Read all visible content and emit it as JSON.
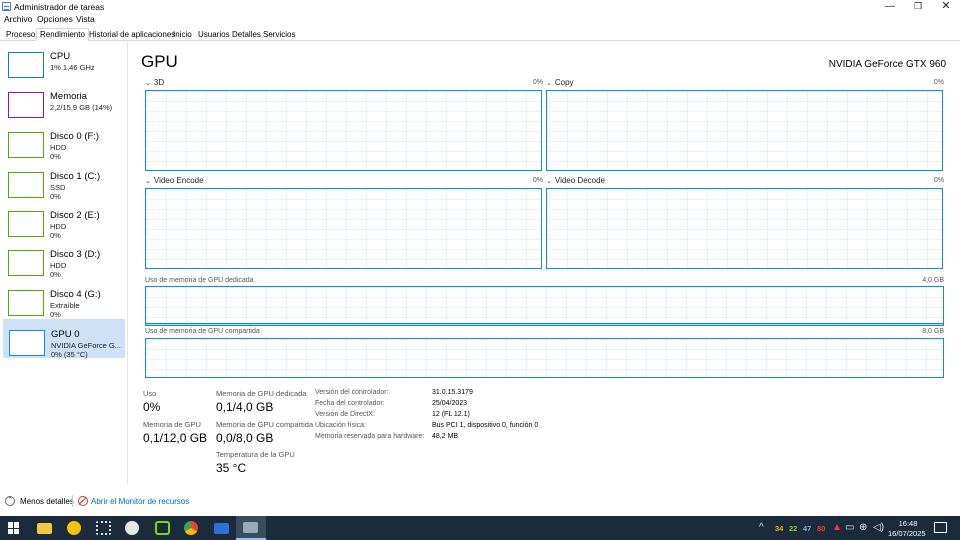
{
  "window": {
    "title": "Administrador de tareas",
    "minimize": "—",
    "maximize": "❐",
    "close": "✕"
  },
  "menu": [
    "Archivo",
    "Opciones",
    "Vista"
  ],
  "tabs": [
    "Procesos",
    "Rendimiento",
    "Historial de aplicaciones",
    "Inicio",
    "Usuarios",
    "Detalles",
    "Servicios"
  ],
  "active_tab": "Rendimiento",
  "sidebar": [
    {
      "name": "CPU",
      "line1": "1% 1,46 GHz",
      "line2": "",
      "color": "#117dbb"
    },
    {
      "name": "Memoria",
      "line1": "2,2/15,9 GB (14%)",
      "line2": "",
      "color": "#8b12ae"
    },
    {
      "name": "Disco 0 (F:)",
      "line1": "HDD",
      "line2": "0%",
      "color": "#4da60c"
    },
    {
      "name": "Disco 1 (C:)",
      "line1": "SSD",
      "line2": "0%",
      "color": "#4da60c"
    },
    {
      "name": "Disco 2 (E:)",
      "line1": "HDD",
      "line2": "0%",
      "color": "#4da60c"
    },
    {
      "name": "Disco 3 (D:)",
      "line1": "HDD",
      "line2": "0%",
      "color": "#4da60c"
    },
    {
      "name": "Disco 4 (G:)",
      "line1": "Extraíble",
      "line2": "0%",
      "color": "#4da60c"
    },
    {
      "name": "GPU 0",
      "line1": "NVIDIA GeForce G...",
      "line2": "0% (35 °C)",
      "color": "#118dd5"
    }
  ],
  "main": {
    "title": "GPU",
    "model": "NVIDIA GeForce GTX 960",
    "engines": [
      {
        "name": "3D",
        "percent": "0%"
      },
      {
        "name": "Copy",
        "percent": "0%"
      },
      {
        "name": "Video Encode",
        "percent": "0%"
      },
      {
        "name": "Video Decode",
        "percent": "0%"
      }
    ],
    "dedicated_label": "Uso de memoria de GPU dedicada",
    "dedicated_max": "4,0 GB",
    "shared_label": "Uso de memoria de GPU compartida",
    "shared_max": "8,0 GB"
  },
  "stats": {
    "uso_label": "Uso",
    "uso_value": "0%",
    "mem_gpu_label": "Memoria de GPU",
    "mem_gpu_value": "0,1/12,0 GB",
    "dedicada_label": "Memoria de GPU dedicada",
    "dedicada_value": "0,1/4,0 GB",
    "compartida_label": "Memoria de GPU compartida",
    "compartida_value": "0,0/8,0 GB",
    "temp_label": "Temperatura de la GPU",
    "temp_value": "35 °C"
  },
  "info": [
    {
      "label": "Versión del controlador:",
      "value": "31.0.15.3179"
    },
    {
      "label": "Fecha del controlador:",
      "value": "25/04/2023"
    },
    {
      "label": "Versión de DirectX:",
      "value": "12 (FL 12.1)"
    },
    {
      "label": "Ubicación física:",
      "value": "Bus PCI 1, dispositivo 0, función 0"
    },
    {
      "label": "Memoria reservada para hardware:",
      "value": "48,2 MB"
    }
  ],
  "footer": {
    "less_details": "Menos detalles",
    "monitor_link": "Abrir el Monitor de recursos"
  },
  "taskbar": {
    "tray": [
      {
        "text": "34",
        "color": "#ffb000"
      },
      {
        "text": "22",
        "color": "#7ed321"
      },
      {
        "text": "47",
        "color": "#5ac8fa"
      },
      {
        "text": "80",
        "color": "#ff3b30"
      }
    ],
    "time": "16:48",
    "date": "16/07/2025"
  }
}
